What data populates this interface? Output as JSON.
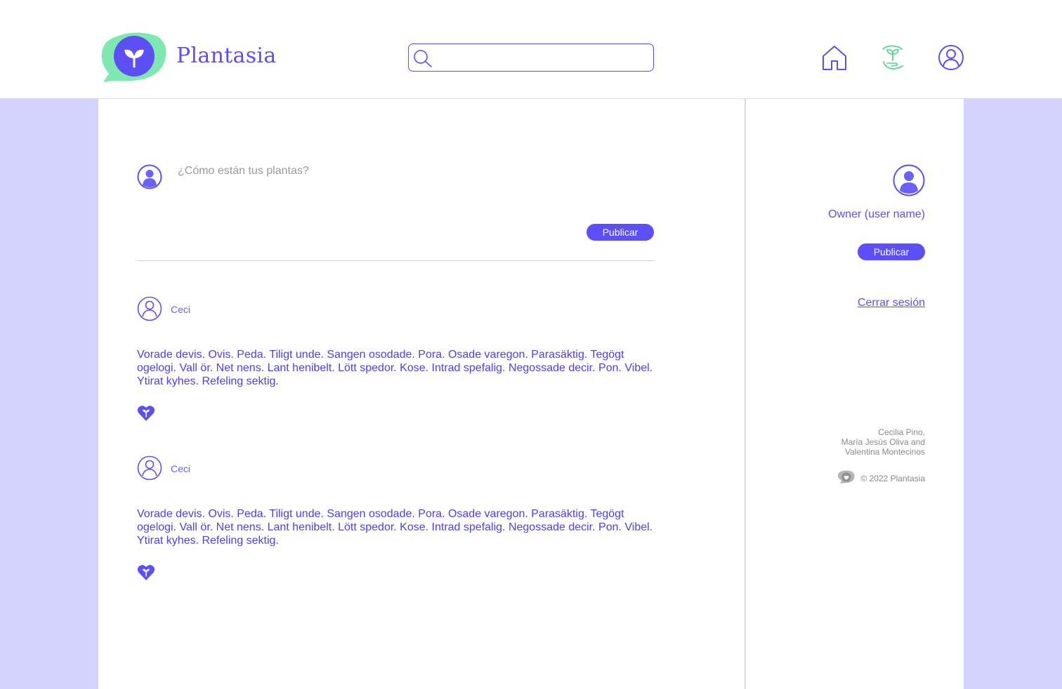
{
  "header": {
    "brand": "Plantasia",
    "search": {
      "placeholder": "",
      "value": ""
    },
    "nav": [
      "home-icon",
      "plant-hands-icon",
      "profile-icon"
    ]
  },
  "compose": {
    "placeholder": "¿Cómo están tus plantas?",
    "publish_label": "Publicar"
  },
  "posts": [
    {
      "author": "Ceci",
      "text": "Vorade devis. Ovis. Peda. Tiligt unde. Sangen osodade. Pora. Osade varegon. Parasäktig. Tegögt ogelogi. Vall ör. Net nens. Lant henibelt. Lött spedor. Kose. Intrad spefalig. Negossade decir. Pon. Vibel. Ytirat kyhes. Refeling sektig."
    },
    {
      "author": "Ceci",
      "text": "Vorade devis. Ovis. Peda. Tiligt unde. Sangen osodade. Pora. Osade varegon. Parasäktig. Tegögt ogelogi. Vall ör. Net nens. Lant henibelt. Lött spedor. Kose. Intrad spefalig. Negossade decir. Pon. Vibel. Ytirat kyhes. Refeling sektig."
    }
  ],
  "sidebar": {
    "owner_name": "Owner (user name)",
    "publish_label": "Publicar",
    "logout_label": "Cerrar sesión",
    "credits": [
      "Cecilia Pino,",
      "María Jesús Oliva and",
      "Valentina Montecinos"
    ],
    "copyright": "© 2022 Plantasia"
  },
  "colors": {
    "accent": "#5b4ff5",
    "mint": "#7ee8b0",
    "page_bg": "#d4d3fc"
  }
}
